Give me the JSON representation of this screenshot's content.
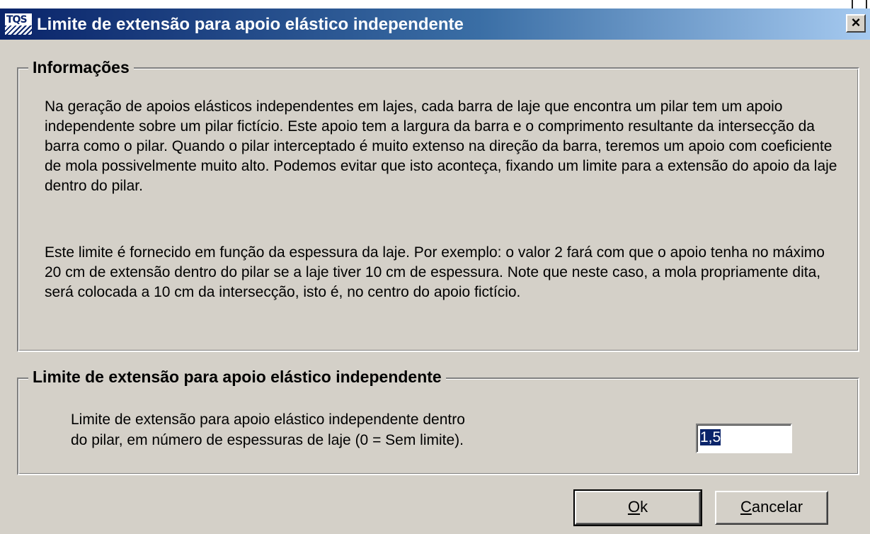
{
  "window": {
    "title": "Limite de extensão para apoio elástico independente",
    "logo_text": "TQS",
    "close_glyph": "×"
  },
  "info_group": {
    "title": "Informações",
    "paragraph1": "Na geração de apoios elásticos independentes em lajes, cada barra de laje que encontra um pilar tem um apoio independente sobre um pilar fictício. Este apoio tem a largura da barra e o comprimento resultante da intersecção da barra como o pilar. Quando o pilar interceptado é muito extenso na direção da barra, teremos um apoio com coeficiente de mola possivelmente muito alto. Podemos evitar que isto aconteça, fixando um limite para a extensão do apoio da laje dentro do pilar.",
    "paragraph2": "Este limite é fornecido em função da espessura da laje. Por exemplo: o valor 2 fará com que o apoio tenha no máximo 20 cm de extensão dentro do pilar se a laje tiver 10 cm de espessura. Note que neste caso, a mola propriamente dita, será colocada a 10 cm da intersecção, isto é, no centro do apoio fictício."
  },
  "limit_group": {
    "title": "Limite de extensão para apoio elástico independente",
    "label_line1": "Limite de extensão para apoio elástico independente dentro",
    "label_line2": "do pilar, em número de espessuras de laje (0 = Sem limite).",
    "input_value": "1,5"
  },
  "buttons": {
    "ok_mnemonic": "O",
    "ok_rest": "k",
    "cancel_mnemonic": "C",
    "cancel_rest": "ancelar"
  },
  "colors": {
    "title_gradient_start": "#0a246a",
    "title_gradient_end": "#a6caf0",
    "dialog_face": "#d4d0c8",
    "selection": "#0a246a"
  },
  "icons": {
    "app_logo": "tqs-logo-icon",
    "close": "close-icon"
  }
}
